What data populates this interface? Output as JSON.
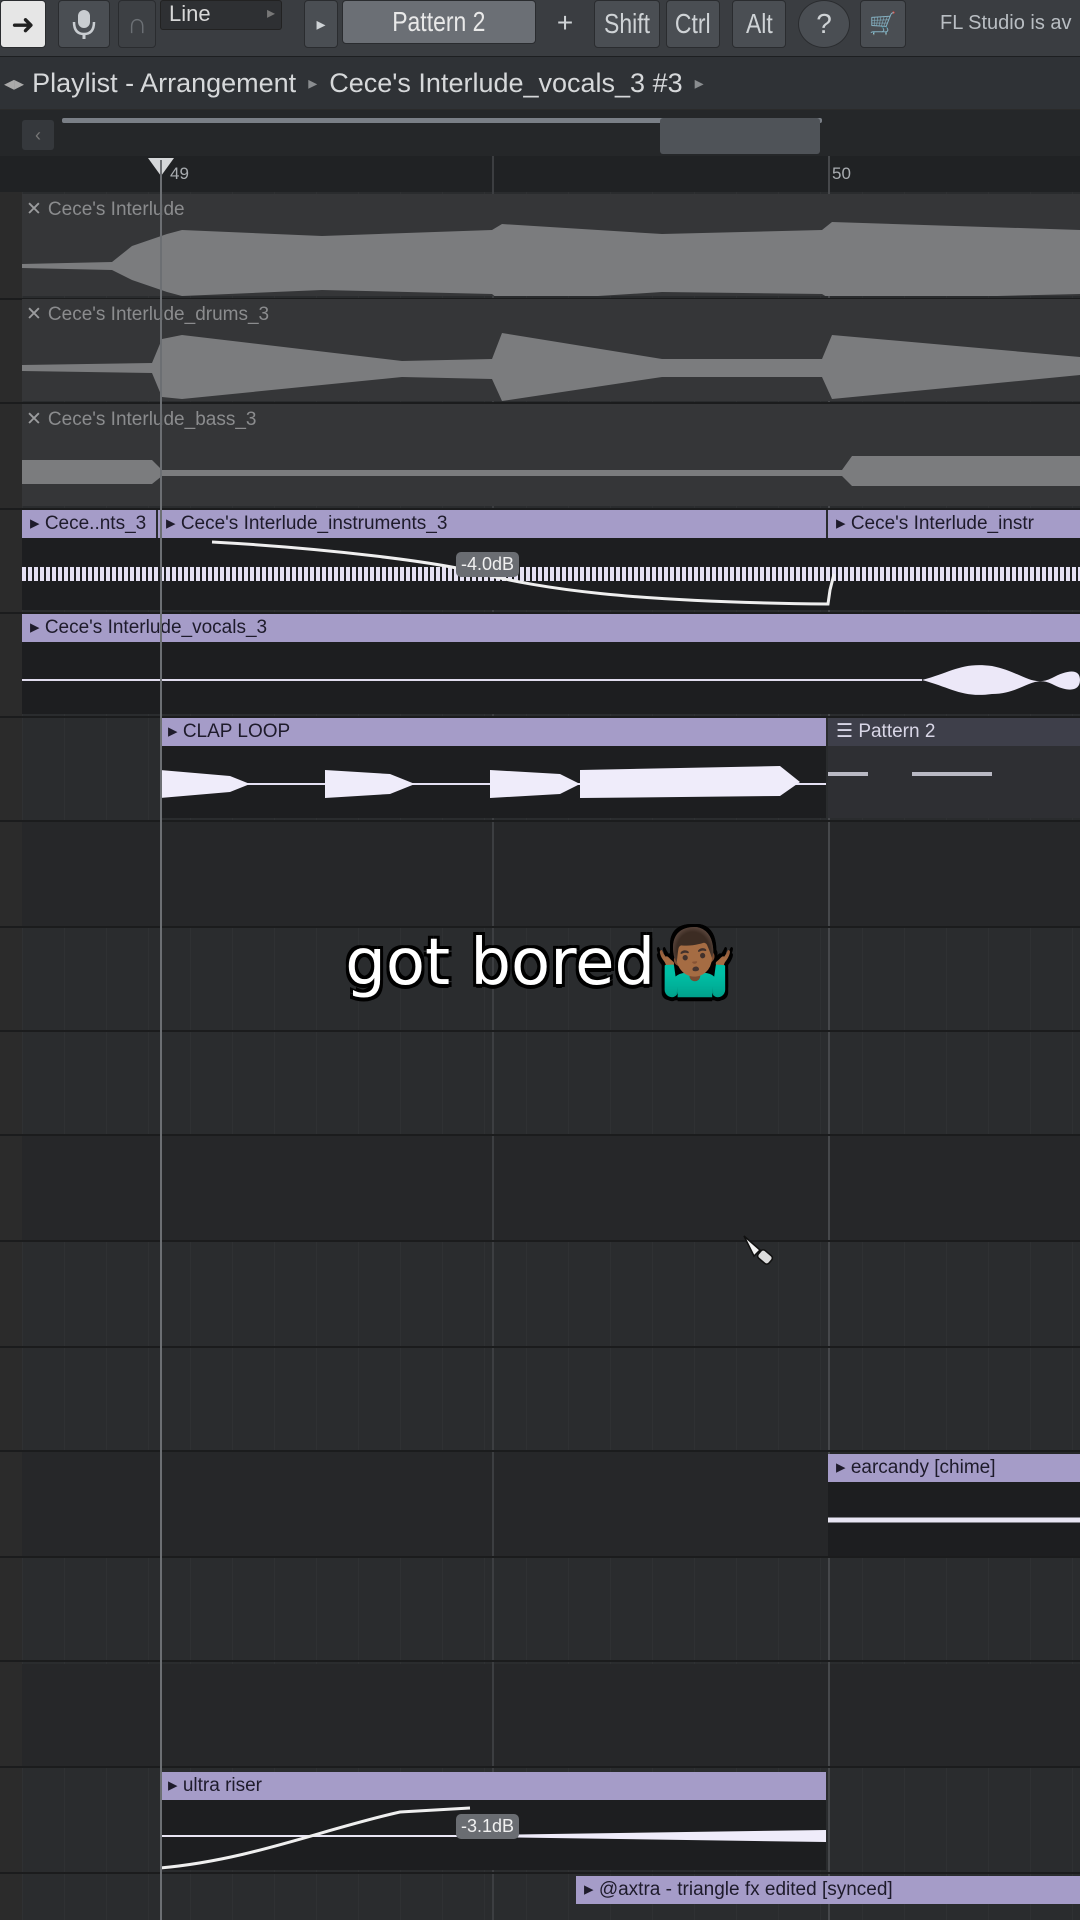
{
  "toolbar": {
    "snap_value": "Line",
    "pattern_value": "Pattern 2",
    "add_pattern_label": "+",
    "shift_label": "Shift",
    "ctrl_label": "Ctrl",
    "alt_label": "Alt",
    "hint_text": "FL Studio is av"
  },
  "titlebar": {
    "window_name": "Playlist - Arrangement",
    "clip_name": "Cece's Interlude_vocals_3 #3"
  },
  "ruler": {
    "marks": [
      "49",
      "50"
    ]
  },
  "tracks": {
    "muted": [
      {
        "label": "Cece's Interlude"
      },
      {
        "label": "Cece's Interlude_drums_3"
      },
      {
        "label": "Cece's Interlude_bass_3"
      }
    ],
    "instruments": {
      "clip_a": "Cece..nts_3",
      "clip_b": "Cece's Interlude_instruments_3",
      "clip_c": "Cece's Interlude_instr",
      "volume": "-4.0dB"
    },
    "vocals": {
      "label": "Cece's Interlude_vocals_3"
    },
    "clap": {
      "label": "CLAP LOOP"
    },
    "pattern": {
      "label": "Pattern 2"
    },
    "earcandy": {
      "label": "earcandy [chime]"
    },
    "riser": {
      "label": "ultra riser",
      "volume": "-3.1dB"
    },
    "triangle": {
      "label": "@axtra - triangle fx edited [synced]"
    }
  },
  "caption": {
    "text": "got bored",
    "emoji": "🤷🏾‍♂️"
  },
  "colors": {
    "clip_header": "#a59cc8",
    "grid_bg": "#2a2c2e",
    "toolbar_bg": "#3a3d41"
  }
}
